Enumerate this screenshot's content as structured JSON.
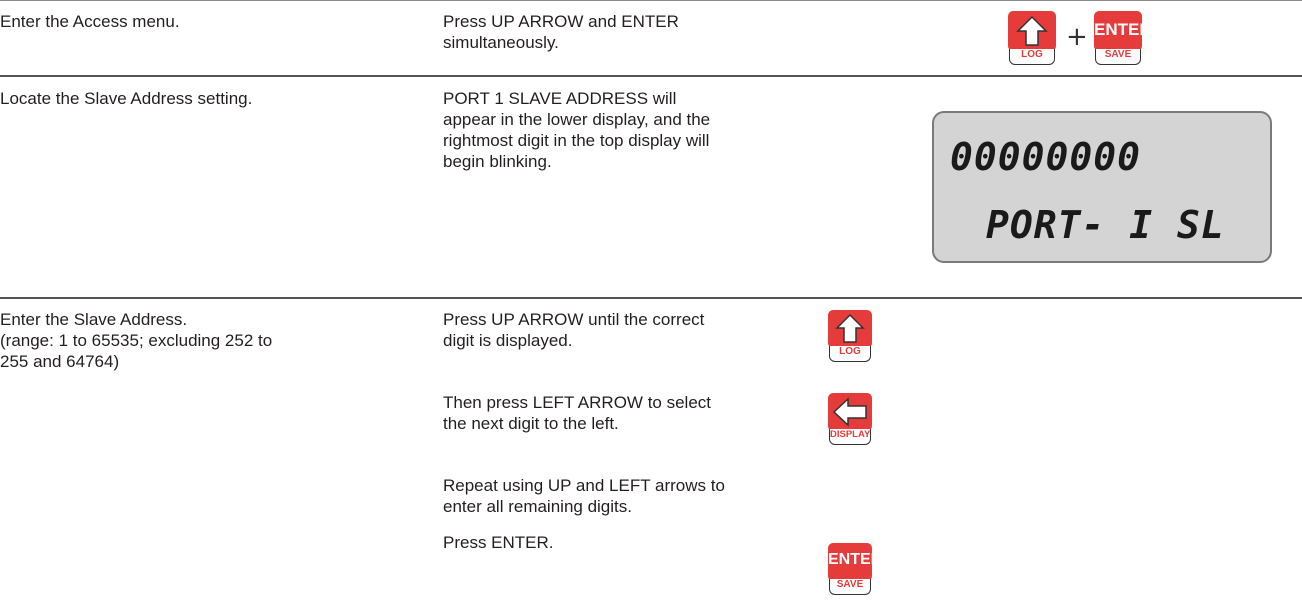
{
  "rows": [
    {
      "step": "Enter the Access menu.",
      "action": [
        "Press UP ARROW and ENTER",
        "simultaneously."
      ]
    },
    {
      "step": "Locate the Slave Address setting.",
      "action": [
        "PORT 1 SLAVE ADDRESS will",
        "appear in the lower display, and the",
        "rightmost digit in the top display will",
        "begin blinking."
      ]
    },
    {
      "step": [
        "Enter the Slave Address.",
        "(range: 1 to 65535; excluding 252 to",
        "255 and 64764)"
      ],
      "actions": [
        [
          "Press UP ARROW until the correct",
          "digit is displayed."
        ],
        [
          "Then press LEFT ARROW to select",
          "the next digit to the left."
        ],
        [
          "Repeat using UP and LEFT arrows to",
          "enter all remaining digits."
        ],
        [
          "Press ENTER."
        ]
      ]
    }
  ],
  "keys": {
    "log_label": "LOG",
    "enter_label": "ENTER",
    "save_label": "SAVE",
    "display_label": "DISPLAY",
    "plus": "+"
  },
  "lcd": {
    "top": "00000000",
    "bottom": "PORT- I SL"
  },
  "colors": {
    "key_red": "#e63b3b",
    "lcd_bg": "#d4d4d4"
  }
}
